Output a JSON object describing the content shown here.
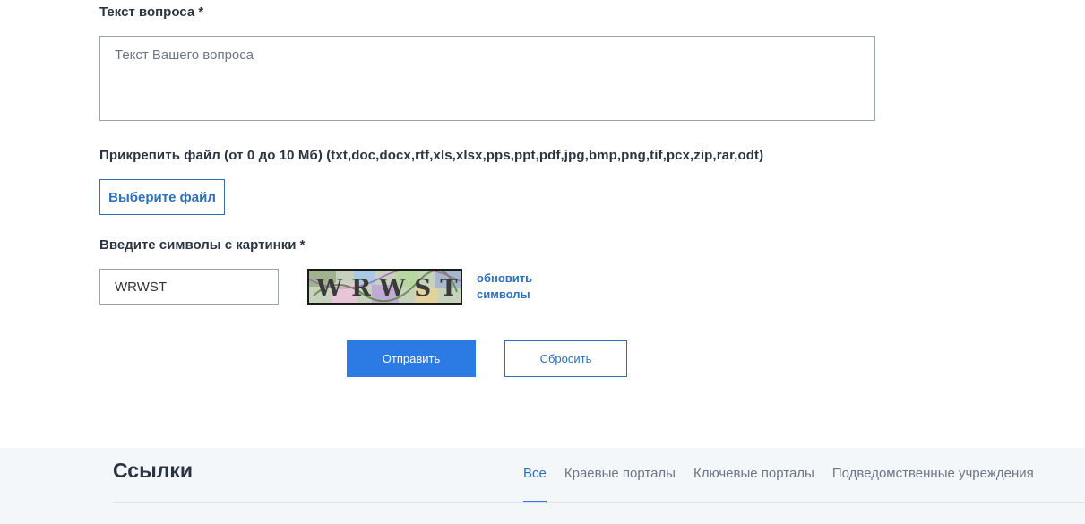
{
  "question": {
    "label": "Текст вопроса *",
    "placeholder": "Текст Вашего вопроса",
    "value": ""
  },
  "attachment": {
    "label": "Прикрепить файл (от 0 до 10 Мб) (txt,doc,docx,rtf,xls,xlsx,pps,ppt,pdf,jpg,bmp,png,tif,pcx,zip,rar,odt)",
    "button_label": "Выберите файл"
  },
  "captcha": {
    "label": "Введите символы с картинки *",
    "value": "WRWST",
    "image_text": "WRWST",
    "refresh_label_line1": "обновить",
    "refresh_label_line2": "символы"
  },
  "actions": {
    "submit_label": "Отправить",
    "reset_label": "Сбросить"
  },
  "links": {
    "title": "Ссылки",
    "tabs": [
      {
        "label": "Все",
        "active": true
      },
      {
        "label": "Краевые порталы",
        "active": false
      },
      {
        "label": "Ключевые порталы",
        "active": false
      },
      {
        "label": "Подведомственные учреждения",
        "active": false
      }
    ]
  },
  "colors": {
    "accent": "#2c7be5",
    "link": "#2d6fb8",
    "footer_bg": "#f4f7fa"
  }
}
